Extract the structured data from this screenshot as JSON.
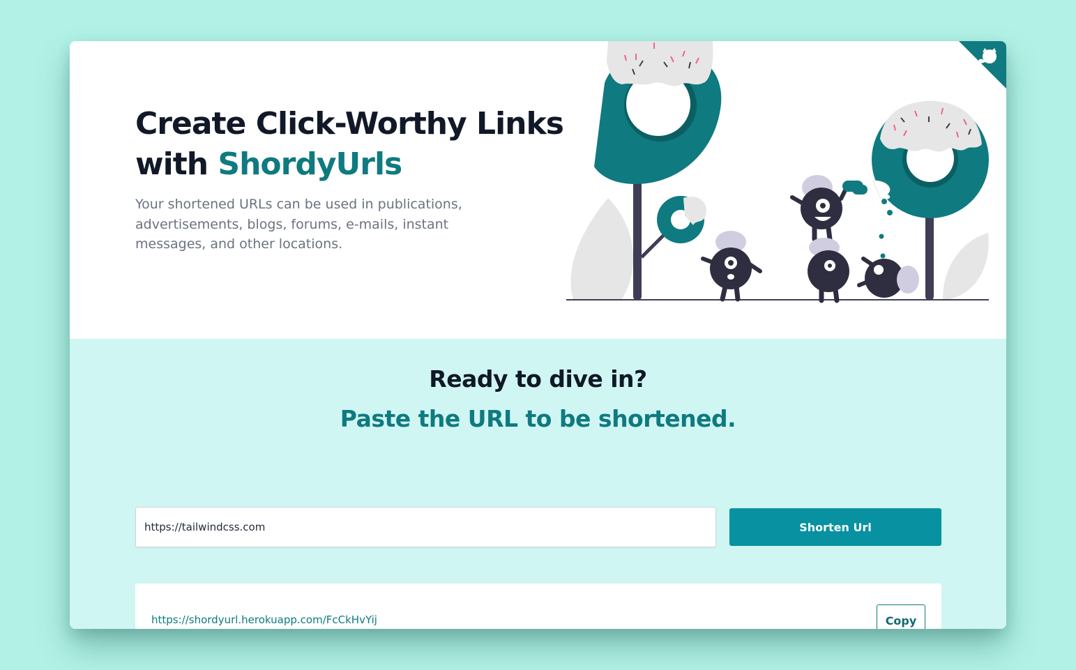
{
  "hero": {
    "title_line1": "Create Click-Worthy Links",
    "title_with": "with",
    "title_brand": "ShordyUrls",
    "subtitle": "Your shortened URLs can be used in publications, advertisements, blogs, forums, e-mails, instant messages, and other locations."
  },
  "cta": {
    "heading": "Ready to dive in?",
    "subheading": "Paste the URL to be shortened."
  },
  "form": {
    "url_value": "https://tailwindcss.com",
    "shorten_label": "Shorten Url"
  },
  "result": {
    "short_url": "https://shordyurl.herokuapp.com/FcCkHvYij",
    "copy_label": "Copy"
  },
  "icons": {
    "corner": "github-octocat-icon"
  },
  "colors": {
    "background": "#b2f2e6",
    "brand": "#0f7a7f",
    "accent_button": "#0891a0",
    "lower_section": "#cff6f3",
    "heading_dark": "#111827"
  }
}
